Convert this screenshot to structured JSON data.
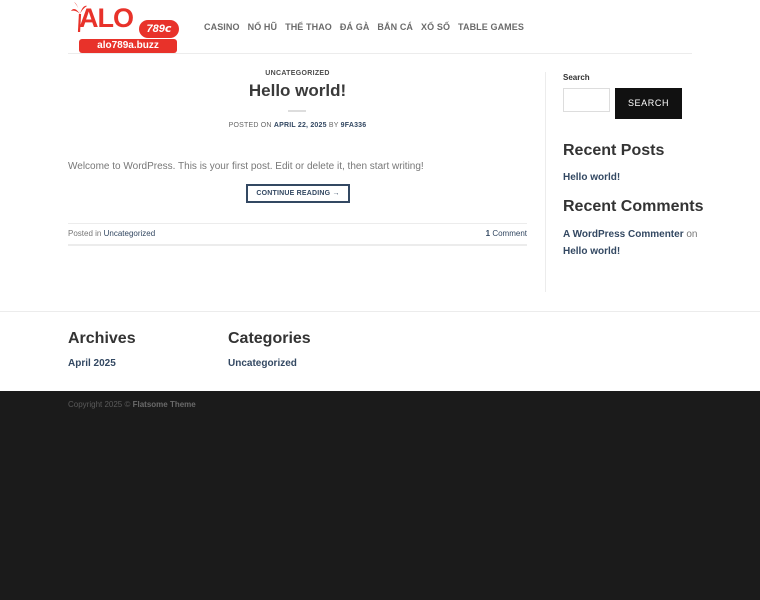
{
  "header": {
    "logo": {
      "wordmark": "ALO",
      "badge": "789",
      "badge_suffix": "ⅽ",
      "url": "alo789a.buzz"
    },
    "nav": [
      "CASINO",
      "NỔ HŨ",
      "THỂ THAO",
      "ĐÁ GÀ",
      "BẮN CÁ",
      "XỔ SỐ",
      "TABLE GAMES"
    ]
  },
  "post": {
    "category": "UNCATEGORIZED",
    "title": "Hello world!",
    "posted_on_prefix": "POSTED ON",
    "date": "APRIL 22, 2025",
    "by": "BY",
    "author": "9FA336",
    "content": "Welcome to WordPress. This is your first post. Edit or delete it, then start writing!",
    "read_more": "CONTINUE READING →",
    "posted_in": "Posted in",
    "posted_in_category": "Uncategorized",
    "comments_count": "1",
    "comments_label": "Comment"
  },
  "sidebar": {
    "search_label": "Search",
    "search_placeholder": "",
    "search_button": "SEARCH",
    "recent_posts_title": "Recent Posts",
    "recent_posts": [
      "Hello world!"
    ],
    "recent_comments_title": "Recent Comments",
    "comment_author": "A WordPress Commenter",
    "comment_on": "on",
    "comment_post": "Hello world!"
  },
  "lower": {
    "archives_title": "Archives",
    "archives": [
      "April 2025"
    ],
    "categories_title": "Categories",
    "categories": [
      "Uncategorized"
    ]
  },
  "footer": {
    "copyright": "Copyright 2025 ©",
    "theme": "Flatsome Theme"
  },
  "colors": {
    "brand_red": "#e8322a",
    "link_blue": "#334862",
    "footer_bg": "#1b1b1b"
  }
}
